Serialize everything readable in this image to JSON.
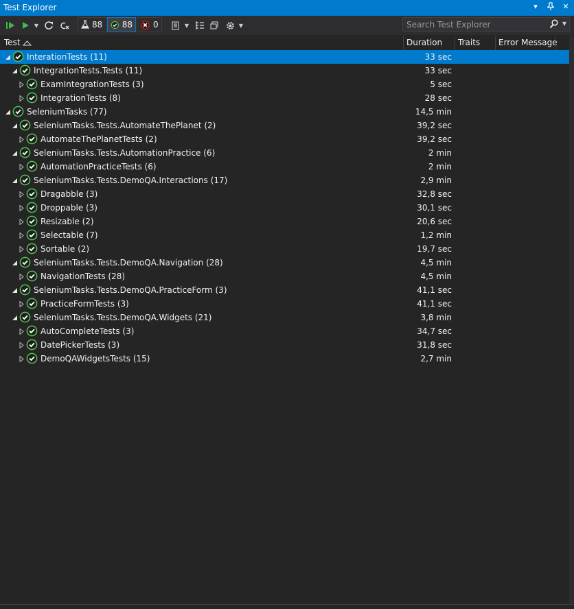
{
  "window": {
    "title": "Test Explorer"
  },
  "toolbar": {
    "filter_total": "88",
    "filter_passed": "88",
    "filter_failed": "0"
  },
  "search": {
    "placeholder": "Search Test Explorer"
  },
  "columns": {
    "test": "Test",
    "duration": "Duration",
    "traits": "Traits",
    "error": "Error Message"
  },
  "tree": [
    {
      "name": "InterationTests (11)",
      "duration": "33 sec",
      "level": 0,
      "expanded": true,
      "selected": true
    },
    {
      "name": "IntegrationTests.Tests (11)",
      "duration": "33 sec",
      "level": 1,
      "expanded": true
    },
    {
      "name": "ExamIntegrationTests (3)",
      "duration": "5 sec",
      "level": 2,
      "expanded": false
    },
    {
      "name": "IntegrationTests (8)",
      "duration": "28 sec",
      "level": 2,
      "expanded": false
    },
    {
      "name": "SeleniumTasks (77)",
      "duration": "14,5 min",
      "level": 0,
      "expanded": true
    },
    {
      "name": "SeleniumTasks.Tests.AutomateThePlanet (2)",
      "duration": "39,2 sec",
      "level": 1,
      "expanded": true
    },
    {
      "name": "AutomateThePlanetTests (2)",
      "duration": "39,2 sec",
      "level": 2,
      "expanded": false
    },
    {
      "name": "SeleniumTasks.Tests.AutomationPractice (6)",
      "duration": "2 min",
      "level": 1,
      "expanded": true
    },
    {
      "name": "AutomationPracticeTests (6)",
      "duration": "2 min",
      "level": 2,
      "expanded": false
    },
    {
      "name": "SeleniumTasks.Tests.DemoQA.Interactions (17)",
      "duration": "2,9 min",
      "level": 1,
      "expanded": true
    },
    {
      "name": "Dragabble (3)",
      "duration": "32,8 sec",
      "level": 2,
      "expanded": false
    },
    {
      "name": "Droppable (3)",
      "duration": "30,1 sec",
      "level": 2,
      "expanded": false
    },
    {
      "name": "Resizable (2)",
      "duration": "20,6 sec",
      "level": 2,
      "expanded": false
    },
    {
      "name": "Selectable (7)",
      "duration": "1,2 min",
      "level": 2,
      "expanded": false
    },
    {
      "name": "Sortable (2)",
      "duration": "19,7 sec",
      "level": 2,
      "expanded": false
    },
    {
      "name": "SeleniumTasks.Tests.DemoQA.Navigation (28)",
      "duration": "4,5 min",
      "level": 1,
      "expanded": true
    },
    {
      "name": "NavigationTests (28)",
      "duration": "4,5 min",
      "level": 2,
      "expanded": false
    },
    {
      "name": "SeleniumTasks.Tests.DemoQA.PracticeForm (3)",
      "duration": "41,1 sec",
      "level": 1,
      "expanded": true
    },
    {
      "name": "PracticeFormTests (3)",
      "duration": "41,1 sec",
      "level": 2,
      "expanded": false
    },
    {
      "name": "SeleniumTasks.Tests.DemoQA.Widgets (21)",
      "duration": "3,8 min",
      "level": 1,
      "expanded": true
    },
    {
      "name": "AutoCompleteTests (3)",
      "duration": "34,7 sec",
      "level": 2,
      "expanded": false
    },
    {
      "name": "DatePickerTests (3)",
      "duration": "31,8 sec",
      "level": 2,
      "expanded": false
    },
    {
      "name": "DemoQAWidgetsTests (15)",
      "duration": "2,7 min",
      "level": 2,
      "expanded": false
    }
  ],
  "colors": {
    "accent": "#007acc",
    "passed": "#4ec94e",
    "failed": "#e51400",
    "background": "#252526"
  }
}
